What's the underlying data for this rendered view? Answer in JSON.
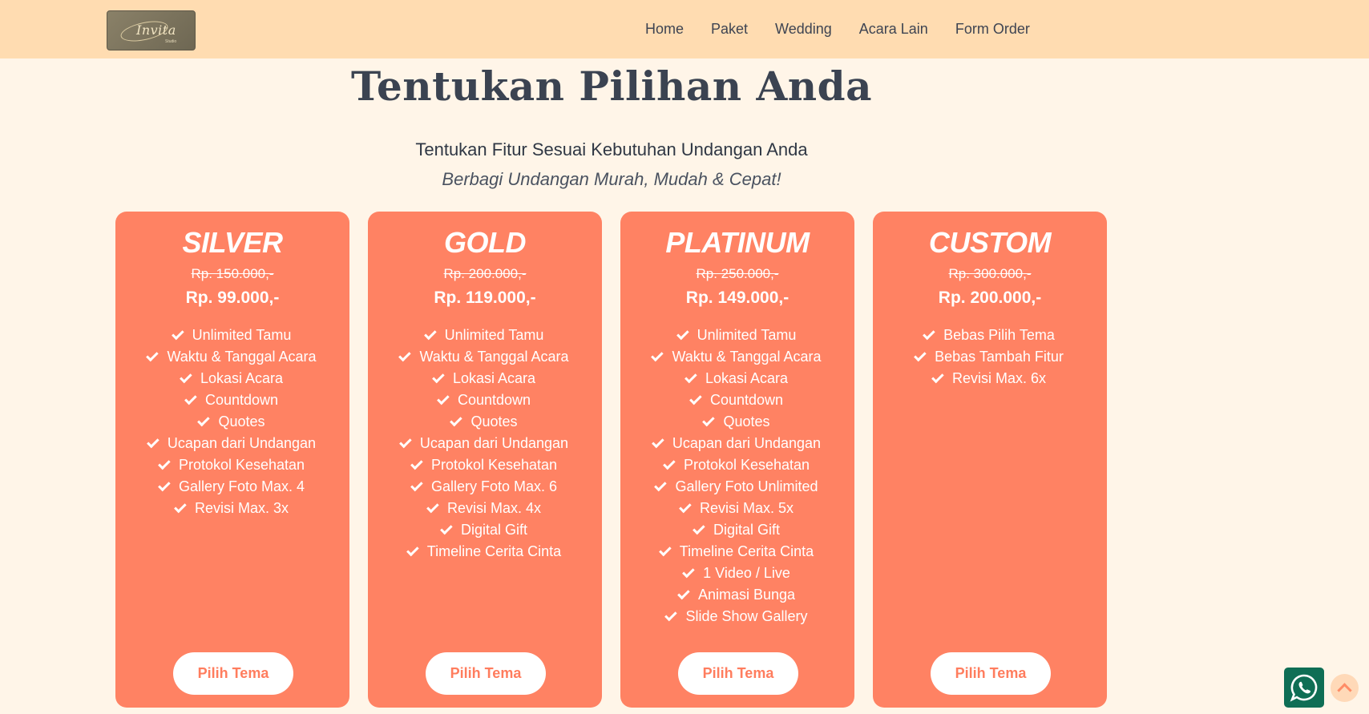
{
  "navbar": {
    "logo_text": "Invita",
    "logo_sub": "Studio",
    "links": [
      "Home",
      "Paket",
      "Wedding",
      "Acara Lain",
      "Form Order"
    ]
  },
  "hero": {
    "title": "Tentukan Pilihan Anda",
    "subtitle": "Tentukan Fitur Sesuai Kebutuhan Undangan Anda",
    "tagline": "Berbagi Undangan Murah, Mudah & Cepat!"
  },
  "plans": [
    {
      "name": "SILVER",
      "old_price": "Rp. 150.000,-",
      "price": "Rp. 99.000,-",
      "features": [
        "Unlimited Tamu",
        "Waktu & Tanggal Acara",
        "Lokasi Acara",
        "Countdown",
        "Quotes",
        "Ucapan dari Undangan",
        "Protokol Kesehatan",
        "Gallery Foto Max. 4",
        "Revisi Max. 3x"
      ],
      "button": "Pilih Tema"
    },
    {
      "name": "GOLD",
      "old_price": "Rp. 200.000,-",
      "price": "Rp. 119.000,-",
      "features": [
        "Unlimited Tamu",
        "Waktu & Tanggal Acara",
        "Lokasi Acara",
        "Countdown",
        "Quotes",
        "Ucapan dari Undangan",
        "Protokol Kesehatan",
        "Gallery Foto Max. 6",
        "Revisi Max. 4x",
        "Digital Gift",
        "Timeline Cerita Cinta"
      ],
      "button": "Pilih Tema"
    },
    {
      "name": "PLATINUM",
      "old_price": "Rp. 250.000,-",
      "price": "Rp. 149.000,-",
      "features": [
        "Unlimited Tamu",
        "Waktu & Tanggal Acara",
        "Lokasi Acara",
        "Countdown",
        "Quotes",
        "Ucapan dari Undangan",
        "Protokol Kesehatan",
        "Gallery Foto Unlimited",
        "Revisi Max. 5x",
        "Digital Gift",
        "Timeline Cerita Cinta",
        "1 Video / Live",
        "Animasi Bunga",
        "Slide Show Gallery"
      ],
      "button": "Pilih Tema"
    },
    {
      "name": "CUSTOM",
      "old_price": "Rp. 300.000,-",
      "price": "Rp. 200.000,-",
      "features": [
        "Bebas Pilih Tema",
        "Bebas Tambah Fitur",
        "Revisi Max. 6x"
      ],
      "button": "Pilih Tema"
    }
  ],
  "floating": {
    "whatsapp_icon": "whatsapp-icon",
    "top_icon": "chevron-up-icon"
  },
  "colors": {
    "navbar_bg": "#ffdcb1",
    "page_bg": "#fff5e8",
    "card_bg": "#ff8263",
    "button_text": "#ff7d5e",
    "whatsapp_bg": "#0f6e55"
  }
}
